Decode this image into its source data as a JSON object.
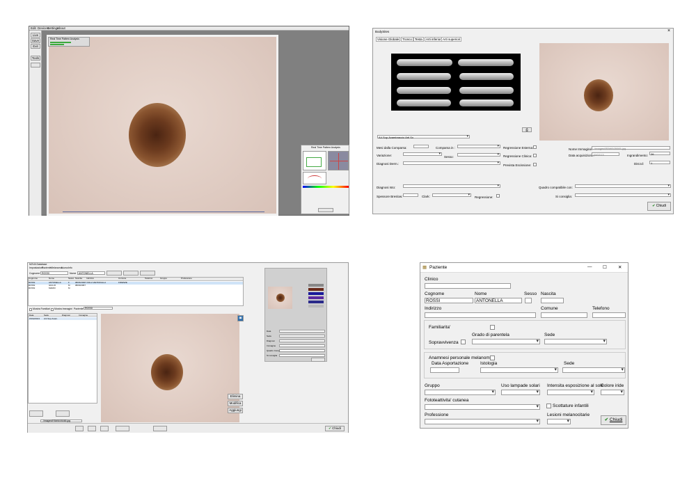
{
  "p1": {
    "menu": [
      "Edit",
      "Devices",
      "Settings",
      "About"
    ],
    "side_buttons": [
      "Live",
      "Save",
      "Exit",
      "Tools"
    ],
    "panel_title": "Real Time Pattern Analysis",
    "mini_panel_title": "Real Time Pattern Analysis"
  },
  "p2": {
    "title": "BodySites",
    "close": "×",
    "tabs": [
      "Visione Globale",
      "Tronco",
      "Testa",
      "Arti inferiori",
      "Arti superiori"
    ],
    "site_select": "A4.Sup.Avambraccio Arti Sx",
    "labels": {
      "mesi": "Mesi dalla Comparsa:",
      "comparsa": "Comparsa in :",
      "reg_esterna": "Regressione Esterna:",
      "variazione": "Variazione:",
      "sesso": "Sesso:",
      "reg_clinica": "Regressione Clinica:",
      "diagnosi_derm": "Diagnosi Derm.:",
      "prevista": "Prevista Escissione:",
      "nome_imm": "Nome Immagine:",
      "data_acq": "Data acquisizione:",
      "ingrand": "Ingrandimento:",
      "dist": "Dist.Id:",
      "diagnosi_isto": "Diagnosi Isto:",
      "spessore": "Spessore Breslow:",
      "clark": "Clark:",
      "regressione": "Regressione:",
      "quadro": "Quadro compatibile con:",
      "consiglia": "Si consiglia:"
    },
    "nome_imm_value": "..\\images\\R5W6\\05085.jpg",
    "data_acq_value": "15/02/13",
    "ingrand_value": "26",
    "dist_value": "1",
    "close_button": "Chiudi"
  },
  "p3": {
    "title": "NOVA Database",
    "menu": [
      "Impostazioni",
      "Paziente",
      "Melanoma",
      "Nuovo",
      "Info"
    ],
    "cognome_label": "Cognome",
    "cognome_value": "ROSSI",
    "nome_label": "Nome",
    "nome_value": "ANTONELLA",
    "table_headers": [
      "Cognome",
      "Nome",
      "Sesso",
      "Nascita",
      "Indirizzo",
      "Comune",
      "Telefono",
      "Gruppo",
      "Professione"
    ],
    "rows": [
      [
        "ROSSI",
        "ANTONELLA",
        "F",
        "08/06/1948",
        "VIOLA VENTAVALLA",
        "FIRENZE",
        "",
        "",
        ""
      ],
      [
        "ROSSI",
        "GIULIO",
        "M",
        "08/09/1967",
        "",
        "",
        "",
        "",
        ""
      ],
      [
        "ROSSI",
        "MARIO",
        "M",
        "",
        "",
        "",
        "",
        "",
        ""
      ]
    ],
    "mostra_familiari": "Mostra Familiari",
    "mostra_immagini": "Mostra Immagini",
    "paziente_label": "Paziente:",
    "paziente_value": "ROSSI",
    "list_headers": [
      "Data",
      "Sede",
      "Diagnosi",
      "Immagine"
    ],
    "list_row": [
      "15/02/2013",
      "Arti Sup.Avam.",
      "",
      ""
    ],
    "preview_labels": [
      "Data",
      "Sede",
      "Diagnosi",
      "Immagine",
      "Quadro Comp.",
      "Si consiglia"
    ],
    "right_buttons": [
      "Elimina",
      "Modifica",
      "Aggiungi"
    ],
    "path_value": "..\\images\\R5W6\\05085.jpg",
    "bottom_buttons": [
      "Chiudi"
    ],
    "nuovo_label": "Nuovo"
  },
  "p4": {
    "title": "Paziente",
    "win_controls": [
      "—",
      "☐",
      "✕"
    ],
    "labels": {
      "clinico": "Clinico",
      "cognome": "Cognome",
      "nome": "Nome",
      "sesso": "Sesso",
      "nascita": "Nascita",
      "indirizzo": "Indirizzo",
      "comune": "Comune",
      "telefono": "Telefono",
      "familiarita": "Familiarita'",
      "sopravvivenza": "Sopravvivenza",
      "grado": "Grado di parentela",
      "sede": "Sede",
      "anamnesi": "Anamnesi personale melanoma",
      "data_asp": "Data Asportazione",
      "istologia": "Istologia",
      "sede2": "Sede",
      "gruppo": "Gruppo",
      "uso_lampade": "Uso lampade solari",
      "intensita": "Intensita esposizione al sole",
      "colore": "Colore iride",
      "foto": "Fototeattivita' cutanea",
      "scottature": "Scottature infantili",
      "professione": "Professione",
      "lesioni": "Lesioni melanocitarie"
    },
    "cognome_value": "ROSSI",
    "nome_value": "ANTONELLA",
    "close_button": "Chiudi"
  }
}
